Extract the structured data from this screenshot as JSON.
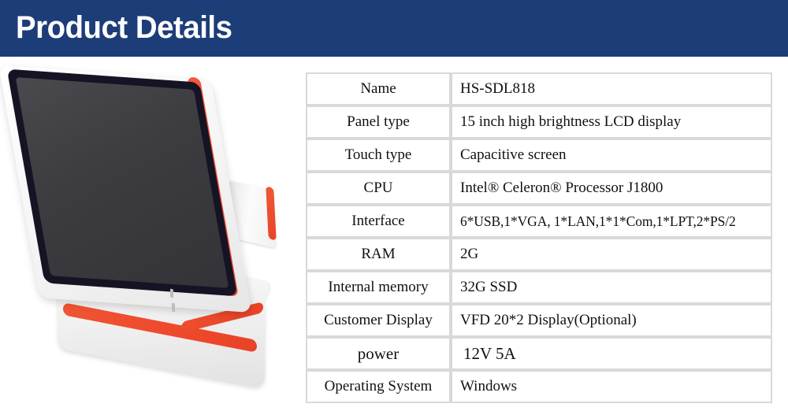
{
  "header": {
    "title": "Product Details",
    "background_color": "#1d3d79",
    "text_color": "#ffffff"
  },
  "product_image": {
    "alt": "White POS terminal with red accent trim, tilted touchscreen and rear customer display",
    "body_color": "#f4f4f4",
    "accent_color": "#ee4d2e",
    "screen_color": "#3c3c40"
  },
  "spec_table": {
    "accent_color": "#cc1f1f",
    "border_color": "#d9d9d9",
    "rows": [
      {
        "label": "Name",
        "value": "HS-SDL818",
        "highlight": false
      },
      {
        "label": "Panel type",
        "value": "15 inch high brightness LCD display",
        "highlight": false
      },
      {
        "label": "Touch type",
        "value": "Capacitive screen",
        "highlight": true
      },
      {
        "label": "CPU",
        "value": "Intel® Celeron® Processor J1800",
        "highlight": false
      },
      {
        "label": "Interface",
        "value": "6*USB,1*VGA, 1*LAN,1*1*Com,1*LPT,2*PS/2",
        "highlight": false
      },
      {
        "label": "RAM",
        "value": "2G",
        "highlight": false
      },
      {
        "label": "Internal memory",
        "value": "32G SSD",
        "highlight": false
      },
      {
        "label": "Customer Display",
        "value": "VFD 20*2 Display(Optional)",
        "highlight": false
      },
      {
        "label": "power",
        "value": "12V 5A",
        "highlight": false
      },
      {
        "label": "Operating System",
        "value": "Windows",
        "highlight": true
      }
    ]
  }
}
